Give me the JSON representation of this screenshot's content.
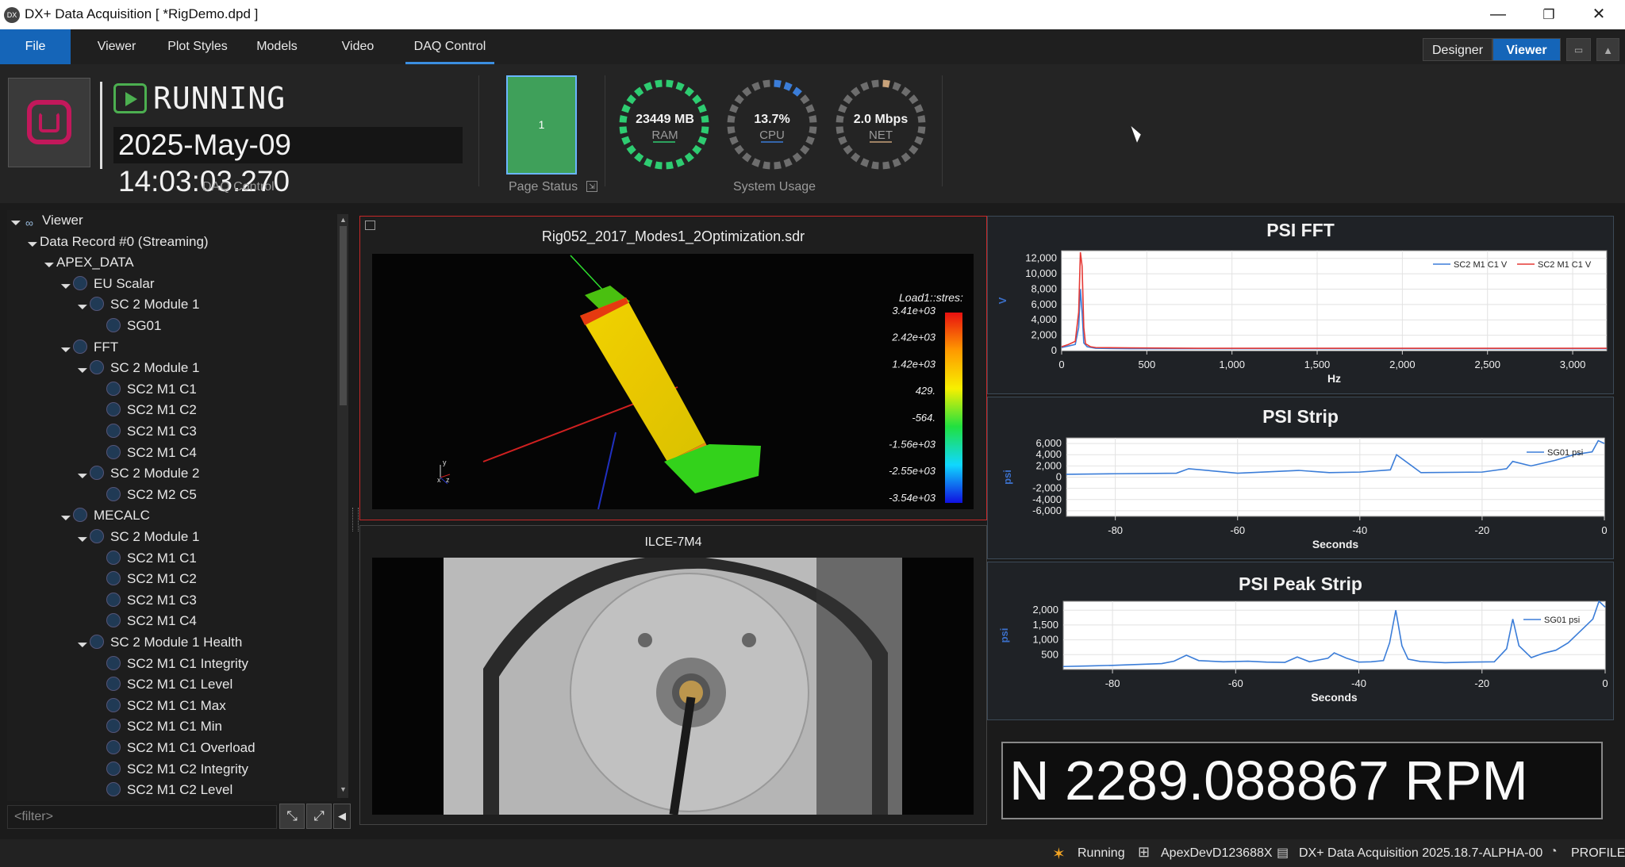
{
  "window": {
    "title": "DX+ Data Acquisition [ *RigDemo.dpd ]",
    "app_icon": "DX",
    "controls": [
      "—",
      "❐",
      "✕"
    ]
  },
  "ribbon_tabs": [
    "File",
    "Viewer",
    "Plot Styles",
    "Models",
    "Video",
    "DAQ Control"
  ],
  "active_tab": "DAQ Control",
  "mode_buttons": {
    "designer": "Designer",
    "viewer": "Viewer"
  },
  "daq": {
    "state": "RUNNING",
    "datetime": "2025-May-09 14:03:03.270",
    "group_label": "DAQ Control"
  },
  "page_status": {
    "value": "1",
    "label": "Page Status"
  },
  "system_usage": {
    "label": "System Usage",
    "gauges": [
      {
        "value": "23449 MB",
        "label": "RAM",
        "color": "#2ecc71",
        "fraction": 1.0
      },
      {
        "value": "13.7%",
        "label": "CPU",
        "color": "#3b7dd8",
        "fraction": 0.137
      },
      {
        "value": "2.0 Mbps",
        "label": "NET",
        "color": "#c8a27a",
        "fraction": 0.05
      }
    ]
  },
  "tree": {
    "items": [
      {
        "label": "Viewer",
        "level": 0,
        "icon": "viewer-icon"
      },
      {
        "label": "Data Record #0 (Streaming)",
        "level": 1,
        "icon": ""
      },
      {
        "label": "APEX_DATA",
        "level": 2,
        "icon": ""
      },
      {
        "label": "EU Scalar",
        "level": 3,
        "icon": "wave-icon"
      },
      {
        "label": "SC 2 Module 1",
        "level": 4,
        "icon": "module-icon"
      },
      {
        "label": "SG01",
        "level": 5,
        "icon": "channel-icon"
      },
      {
        "label": "FFT",
        "level": 3,
        "icon": "fft-icon"
      },
      {
        "label": "SC 2 Module 1",
        "level": 4,
        "icon": "module-icon"
      },
      {
        "label": "SC2 M1 C1",
        "level": 5,
        "icon": "channel-icon"
      },
      {
        "label": "SC2 M1 C2",
        "level": 5,
        "icon": "channel-icon"
      },
      {
        "label": "SC2 M1 C3",
        "level": 5,
        "icon": "channel-icon"
      },
      {
        "label": "SC2 M1 C4",
        "level": 5,
        "icon": "channel-icon"
      },
      {
        "label": "SC 2 Module 2",
        "level": 4,
        "icon": "module-icon"
      },
      {
        "label": "SC2 M2 C5",
        "level": 5,
        "icon": "channel-icon"
      },
      {
        "label": "MECALC",
        "level": 3,
        "icon": "mecalc-icon"
      },
      {
        "label": "SC 2 Module 1",
        "level": 4,
        "icon": "module-icon"
      },
      {
        "label": "SC2 M1 C1",
        "level": 5,
        "icon": "channel-icon"
      },
      {
        "label": "SC2 M1 C2",
        "level": 5,
        "icon": "channel-icon"
      },
      {
        "label": "SC2 M1 C3",
        "level": 5,
        "icon": "channel-icon"
      },
      {
        "label": "SC2 M1 C4",
        "level": 5,
        "icon": "channel-icon"
      },
      {
        "label": "SC 2 Module 1 Health",
        "level": 4,
        "icon": "module-icon"
      },
      {
        "label": "SC2 M1 C1 Integrity",
        "level": 5,
        "icon": "channel-icon"
      },
      {
        "label": "SC2 M1 C1 Level",
        "level": 5,
        "icon": "channel-icon"
      },
      {
        "label": "SC2 M1 C1 Max",
        "level": 5,
        "icon": "channel-icon"
      },
      {
        "label": "SC2 M1 C1 Min",
        "level": 5,
        "icon": "channel-icon"
      },
      {
        "label": "SC2 M1 C1 Overload",
        "level": 5,
        "icon": "channel-icon"
      },
      {
        "label": "SC2 M1 C2 Integrity",
        "level": 5,
        "icon": "channel-icon"
      },
      {
        "label": "SC2 M1 C2 Level",
        "level": 5,
        "icon": "channel-icon"
      }
    ],
    "filter_placeholder": "<filter>"
  },
  "model_view": {
    "title": "Rig052_2017_Modes1_2Optimization.sdr",
    "legend_title": "Load1::stres:",
    "legend_values": [
      "3.41e+03",
      "2.42e+03",
      "1.42e+03",
      "429.",
      "-564.",
      "-1.56e+03",
      "-2.55e+03",
      "-3.54e+03"
    ],
    "axis_labels": [
      "y",
      "x",
      "z"
    ]
  },
  "video_view": {
    "title": "ILCE-7M4"
  },
  "chart_data": [
    {
      "type": "line",
      "title": "PSI FFT",
      "xlabel": "Hz",
      "ylabel": "V",
      "xlim": [
        0,
        3200
      ],
      "ylim": [
        0,
        13000
      ],
      "xticks": [
        0,
        500,
        1000,
        1500,
        2000,
        2500,
        3000
      ],
      "xtick_labels": [
        "0",
        "500",
        "1,000",
        "1,500",
        "2,000",
        "2,500",
        "3,000"
      ],
      "yticks": [
        0,
        2000,
        4000,
        6000,
        8000,
        10000,
        12000
      ],
      "ytick_labels": [
        "0",
        "2,000",
        "4,000",
        "6,000",
        "8,000",
        "10,000",
        "12,000"
      ],
      "legend": "top-right",
      "series": [
        {
          "name": "SC2 M1 C1 V",
          "color": "#3b7dd8",
          "x": [
            0,
            40,
            80,
            100,
            110,
            120,
            130,
            150,
            200,
            400,
            800,
            1200,
            1600,
            2000,
            2400,
            2800,
            3200
          ],
          "y": [
            400,
            600,
            800,
            3000,
            8000,
            5000,
            1000,
            500,
            300,
            250,
            250,
            250,
            250,
            250,
            250,
            250,
            250
          ]
        },
        {
          "name": "SC2 M1 C1 V",
          "color": "#e53935",
          "x": [
            0,
            40,
            80,
            100,
            110,
            120,
            130,
            140,
            170,
            200,
            400,
            800,
            1200,
            1600,
            2000,
            2400,
            2800,
            3200
          ],
          "y": [
            500,
            800,
            1200,
            5000,
            12800,
            11000,
            3000,
            900,
            500,
            400,
            350,
            300,
            300,
            300,
            300,
            300,
            300,
            300
          ]
        }
      ]
    },
    {
      "type": "line",
      "title": "PSI Strip",
      "xlabel": "Seconds",
      "ylabel": "psi",
      "xlim": [
        -88,
        0
      ],
      "ylim": [
        -7000,
        7000
      ],
      "xticks": [
        -80,
        -60,
        -40,
        -20,
        0
      ],
      "xtick_labels": [
        "-80",
        "-60",
        "-40",
        "-20",
        "0"
      ],
      "yticks": [
        6000,
        4000,
        2000,
        0,
        -2000,
        -4000,
        -6000
      ],
      "ytick_labels": [
        "6,000",
        "4,000",
        "2,000",
        "0",
        "-2,000",
        "-4,000",
        "-6,000"
      ],
      "legend": "top-right",
      "series": [
        {
          "name": "SG01 psi",
          "color": "#3b7dd8",
          "x": [
            -88,
            -80,
            -70,
            -68,
            -60,
            -50,
            -45,
            -40,
            -35,
            -34,
            -30,
            -20,
            -16,
            -15,
            -12,
            -8,
            -5,
            -2,
            -1,
            0
          ],
          "y": [
            500,
            600,
            700,
            1500,
            700,
            1200,
            800,
            900,
            1300,
            4000,
            800,
            900,
            1500,
            2800,
            2000,
            3000,
            4000,
            4500,
            6500,
            6000
          ]
        }
      ]
    },
    {
      "type": "line",
      "title": "PSI Peak Strip",
      "xlabel": "Seconds",
      "ylabel": "psi",
      "xlim": [
        -88,
        0
      ],
      "ylim": [
        0,
        2300
      ],
      "xticks": [
        -80,
        -60,
        -40,
        -20,
        0
      ],
      "xtick_labels": [
        "-80",
        "-60",
        "-40",
        "-20",
        "0"
      ],
      "yticks": [
        500,
        1000,
        1500,
        2000
      ],
      "ytick_labels": [
        "500",
        "1,000",
        "1,500",
        "2,000"
      ],
      "legend": "top-right",
      "series": [
        {
          "name": "SG01 psi",
          "color": "#3b7dd8",
          "x": [
            -88,
            -84,
            -80,
            -76,
            -72,
            -70,
            -68,
            -66,
            -62,
            -58,
            -55,
            -52,
            -50,
            -48,
            -45,
            -44,
            -42,
            -40,
            -38,
            -36,
            -35,
            -34,
            -33,
            -32,
            -30,
            -26,
            -22,
            -18,
            -16,
            -15,
            -14,
            -12,
            -10,
            -8,
            -6,
            -4,
            -2,
            -1,
            0
          ],
          "y": [
            100,
            120,
            140,
            170,
            200,
            280,
            480,
            300,
            260,
            280,
            250,
            240,
            420,
            260,
            380,
            560,
            380,
            250,
            260,
            300,
            900,
            2000,
            800,
            350,
            270,
            230,
            250,
            260,
            700,
            1700,
            800,
            400,
            550,
            650,
            900,
            1300,
            1700,
            2300,
            2100
          ]
        }
      ]
    }
  ],
  "rpm_display": "N 2289.088867 RPM",
  "statusbar": {
    "state": "Running",
    "host": "ApexDevD123688X",
    "version": "DX+ Data Acquisition 2025.18.7-ALPHA-00",
    "profile": "PROFILE!"
  }
}
